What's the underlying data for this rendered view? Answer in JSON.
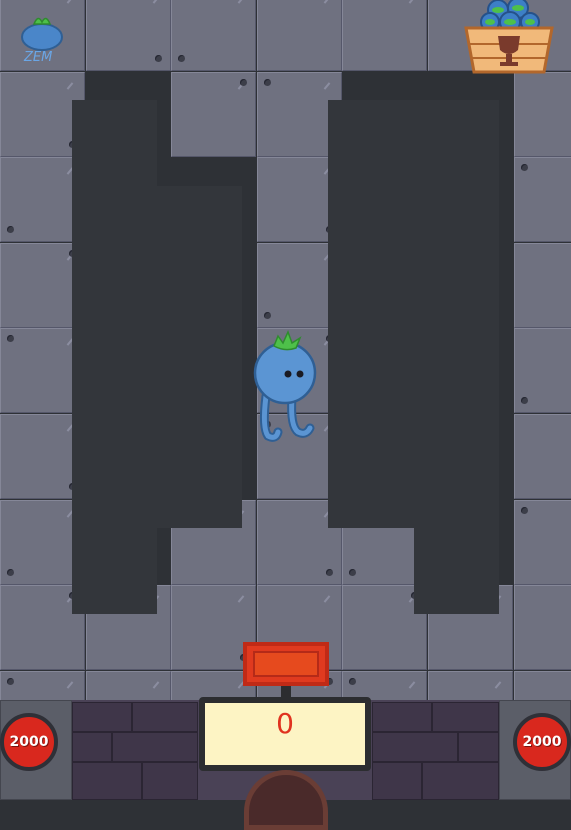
{
  "hud": {
    "player_icon": "blueberry-icon",
    "player_label": "ZEM",
    "trophy_icon": "trophy-basket-icon"
  },
  "counter": {
    "value": "0"
  },
  "buttons": {
    "left_value": "2000",
    "right_value": "2000"
  },
  "character": {
    "icon": "blueberry-character-icon"
  },
  "colors": {
    "tile": "#6f7180",
    "pit": "#33363b",
    "button": "#d9281e",
    "screen": "#fdf4c4",
    "counter_text": "#e0321f",
    "character": "#4a86c9"
  }
}
